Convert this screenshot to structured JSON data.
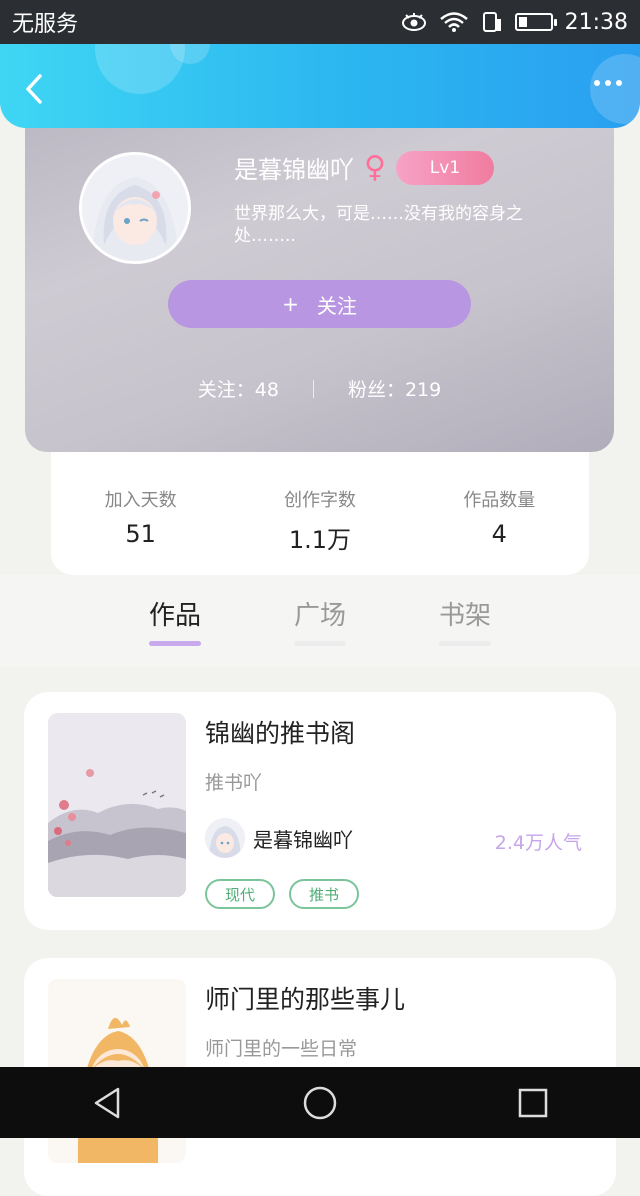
{
  "status_bar": {
    "carrier": "无服务",
    "time": "21:38",
    "icons": [
      "eye-icon",
      "wifi-icon",
      "sim-icon",
      "battery-icon"
    ]
  },
  "header": {
    "back_icon": "chevron-left-icon",
    "more_icon": "more-dots-icon"
  },
  "profile": {
    "username": "是暮锦幽吖",
    "gender_symbol": "♀",
    "level": "Lv1",
    "bio": "世界那么大，可是……没有我的容身之处……..",
    "follow_button": {
      "plus": "+",
      "label": "关注"
    },
    "following_text": "关注：48",
    "followers_text": "粉丝：219"
  },
  "stats": [
    {
      "label": "加入天数",
      "value": "51"
    },
    {
      "label": "创作字数",
      "value": "1.1万"
    },
    {
      "label": "作品数量",
      "value": "4"
    }
  ],
  "tabs": [
    {
      "label": "作品",
      "active": true
    },
    {
      "label": "广场",
      "active": false
    },
    {
      "label": "书架",
      "active": false
    }
  ],
  "works": [
    {
      "title": "锦幽的推书阁",
      "desc": "推书吖",
      "author": "是暮锦幽吖",
      "popularity": "2.4万人气",
      "tags": [
        "现代",
        "推书"
      ]
    },
    {
      "title": "师门里的那些事儿",
      "desc": "师门里的一些日常"
    }
  ],
  "colors": {
    "header_start": "#3fd6f4",
    "header_end": "#2a9ff0",
    "accent_purple": "#b996e2",
    "tag_green": "#4fae76",
    "level_pink": "#f07ca0"
  },
  "nav_bar": [
    "back-triangle-icon",
    "home-circle-icon",
    "recents-square-icon"
  ]
}
